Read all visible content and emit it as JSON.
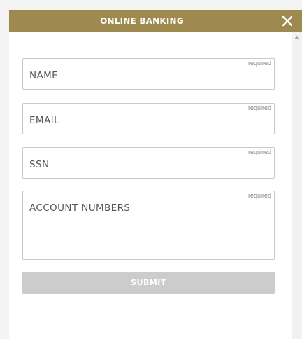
{
  "modal": {
    "title": "ONLINE BANKING",
    "close_icon": "close-icon"
  },
  "form": {
    "fields": [
      {
        "label": "NAME",
        "required": "required"
      },
      {
        "label": "EMAIL",
        "required": "required"
      },
      {
        "label": "SSN",
        "required": "required"
      },
      {
        "label": "ACCOUNT NUMBERS",
        "required": "required"
      }
    ],
    "submit_label": "SUBMIT"
  },
  "colors": {
    "header": "#9e8a4e",
    "submit_disabled": "#cccccc",
    "field_border": "#c9c9c9"
  }
}
